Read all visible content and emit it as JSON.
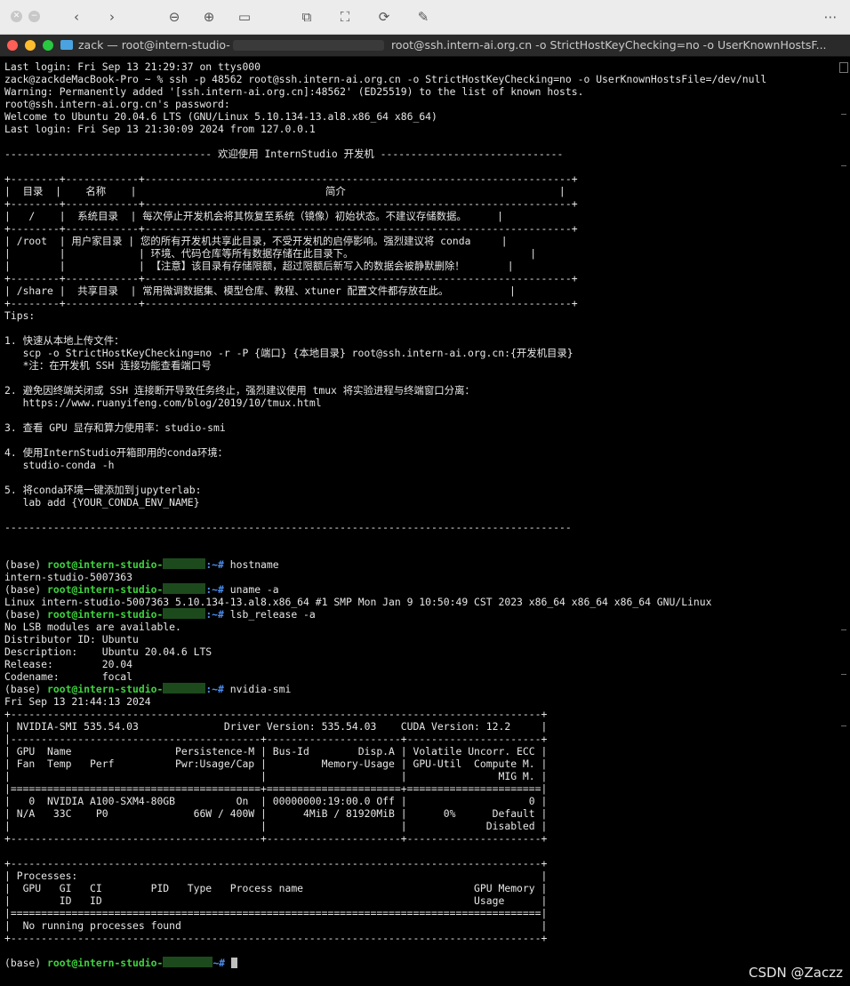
{
  "viewer": {
    "buttons": [
      "back",
      "forward",
      "zoom-out",
      "zoom-in",
      "fit",
      "share",
      "crop",
      "rotate",
      "markup",
      "more"
    ]
  },
  "window": {
    "title_left": "zack — root@intern-studio-",
    "title_right": "root@ssh.intern-ai.org.cn -o StrictHostKeyChecking=no -o UserKnownHostsF..."
  },
  "terminal": {
    "login_line": "Last login: Fri Sep 13 21:29:37 on ttys000",
    "ssh_cmd": "zack@zackdeMacBook-Pro ~ % ssh -p 48562 root@ssh.intern-ai.org.cn -o StrictHostKeyChecking=no -o UserKnownHostsFile=/dev/null",
    "warning": "Warning: Permanently added '[ssh.intern-ai.org.cn]:48562' (ED25519) to the list of known hosts.",
    "password": "root@ssh.intern-ai.org.cn's password:",
    "welcome": "Welcome to Ubuntu 20.04.6 LTS (GNU/Linux 5.10.134-13.al8.x86_64 x86_64)",
    "last_login2": "Last login: Fri Sep 13 21:30:09 2024 from 127.0.0.1",
    "banner": "---------------------------------- 欢迎使用 InternStudio 开发机 ------------------------------",
    "table": [
      "+--------+------------+----------------------------------------------------------------------+",
      "|  目录  |    名称    |                               简介                                   |",
      "+--------+------------+----------------------------------------------------------------------+",
      "|   /    |  系统目录  | 每次停止开发机会将其恢复至系统（镜像）初始状态。不建议存储数据。     |",
      "+--------+------------+----------------------------------------------------------------------+",
      "| /root  | 用户家目录 | 您的所有开发机共享此目录，不受开发机的启停影响。强烈建议将 conda     |",
      "|        |            | 环境、代码仓库等所有数据存储在此目录下。                             |",
      "|        |            | 【注意】该目录有存储限额，超过限额后新写入的数据会被静默删除！       |",
      "+--------+------------+----------------------------------------------------------------------+",
      "| /share |  共享目录  | 常用微调数据集、模型仓库、教程、xtuner 配置文件都存放在此。          |",
      "+--------+------------+----------------------------------------------------------------------+"
    ],
    "tips": [
      "Tips:",
      "",
      "1. 快速从本地上传文件：",
      "   scp -o StrictHostKeyChecking=no -r -P {端口} {本地目录} root@ssh.intern-ai.org.cn:{开发机目录}",
      "   *注：在开发机 SSH 连接功能查看端口号",
      "",
      "2. 避免因终端关闭或 SSH 连接断开导致任务终止，强烈建议使用 tmux 将实验进程与终端窗口分离：",
      "   https://www.ruanyifeng.com/blog/2019/10/tmux.html",
      "",
      "3. 查看 GPU 显存和算力使用率：studio-smi",
      "",
      "4. 使用InternStudio开箱即用的conda环境：",
      "   studio-conda -h",
      "",
      "5. 将conda环境一键添加到jupyterlab:",
      "   lab add {YOUR_CONDA_ENV_NAME}",
      "",
      "---------------------------------------------------------------------------------------------",
      "",
      ""
    ],
    "prompt_base": "(base) ",
    "prompt_user": "root@intern-studio-",
    "prompt_tail": ":~# ",
    "cmd_hostname": "hostname",
    "out_hostname": "intern-studio-5007363",
    "cmd_uname": "uname -a",
    "out_uname": "Linux intern-studio-5007363 5.10.134-13.al8.x86_64 #1 SMP Mon Jan 9 10:50:49 CST 2023 x86_64 x86_64 x86_64 GNU/Linux",
    "cmd_lsb": "lsb_release -a",
    "out_lsb": [
      "No LSB modules are available.",
      "Distributor ID: Ubuntu",
      "Description:    Ubuntu 20.04.6 LTS",
      "Release:        20.04",
      "Codename:       focal"
    ],
    "cmd_nvidia": "nvidia-smi",
    "out_nvidia": [
      "Fri Sep 13 21:44:13 2024",
      "+---------------------------------------------------------------------------------------+",
      "| NVIDIA-SMI 535.54.03              Driver Version: 535.54.03    CUDA Version: 12.2     |",
      "|-----------------------------------------+----------------------+----------------------+",
      "| GPU  Name                 Persistence-M | Bus-Id        Disp.A | Volatile Uncorr. ECC |",
      "| Fan  Temp   Perf          Pwr:Usage/Cap |         Memory-Usage | GPU-Util  Compute M. |",
      "|                                         |                      |               MIG M. |",
      "|=========================================+======================+======================|",
      "|   0  NVIDIA A100-SXM4-80GB          On  | 00000000:19:00.0 Off |                    0 |",
      "| N/A   33C    P0              66W / 400W |      4MiB / 81920MiB |      0%      Default |",
      "|                                         |                      |             Disabled |",
      "+-----------------------------------------+----------------------+----------------------+",
      "",
      "+---------------------------------------------------------------------------------------+",
      "| Processes:                                                                            |",
      "|  GPU   GI   CI        PID   Type   Process name                            GPU Memory |",
      "|        ID   ID                                                             Usage      |",
      "|=======================================================================================|",
      "|  No running processes found                                                           |",
      "+---------------------------------------------------------------------------------------+"
    ]
  },
  "watermark": "CSDN @Zaczz",
  "colors": {
    "prompt_user": "#3fd23f",
    "prompt_path": "#4d8ff0",
    "terminal_bg": "#000000"
  }
}
